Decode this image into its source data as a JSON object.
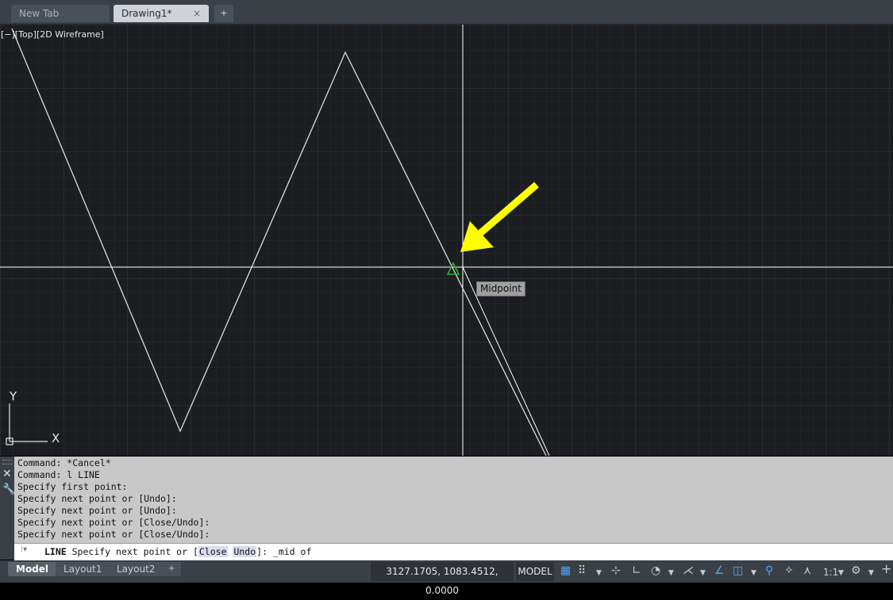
{
  "tabs": {
    "new_tab": "New Tab",
    "drawing": "Drawing1*",
    "close_glyph": "×",
    "add_glyph": "+"
  },
  "viewport": {
    "label": "[−][Top][2D Wireframe]",
    "tooltip": "Midpoint",
    "ucs_x": "X",
    "ucs_y": "Y",
    "annotation_color": "#ffff00",
    "snap_marker_color": "#2db82d"
  },
  "command_history": [
    "Command: *Cancel*",
    "Command: l LINE",
    "Specify first point:",
    "Specify next point or [Undo]:",
    "Specify next point or [Undo]:",
    "Specify next point or [Close/Undo]:",
    "Specify next point or [Close/Undo]:"
  ],
  "command_input": {
    "command": "LINE",
    "prompt_start": " Specify next point or [",
    "option_close": "Close",
    "option_undo": "Undo",
    "prompt_end": "]: _mid of"
  },
  "layout_tabs": {
    "model": "Model",
    "layout1": "Layout1",
    "layout2": "Layout2",
    "add": "+"
  },
  "status": {
    "coordinates": "3127.1705, 1083.4512, 0.0000",
    "model": "MODEL",
    "scale": "1:1"
  }
}
